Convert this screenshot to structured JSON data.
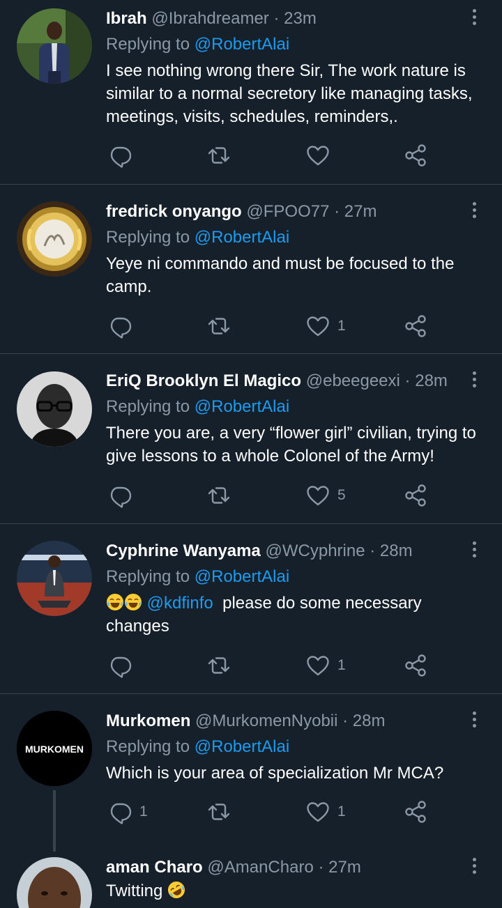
{
  "tweets": [
    {
      "name": "Ibrah",
      "handle": "@Ibrahdreamer",
      "sep": "·",
      "time": "23m",
      "replying_prefix": "Replying to",
      "replying_to": "@RobertAlai",
      "text": "I see nothing wrong there Sir, The work nature is similar to a normal secretory like managing tasks, meetings, visits, schedules, reminders,.",
      "reply_count": "",
      "retweet_count": "",
      "like_count": ""
    },
    {
      "name": "fredrick onyango",
      "handle": "@FPOO77",
      "sep": "·",
      "time": "27m",
      "replying_prefix": "Replying to",
      "replying_to": "@RobertAlai",
      "text": "Yeye ni commando and must be focused to the camp.",
      "reply_count": "",
      "retweet_count": "",
      "like_count": "1"
    },
    {
      "name": "EriQ Brooklyn El Magico",
      "handle": "@ebeegeexi",
      "sep": "·",
      "time": "28m",
      "replying_prefix": "Replying to",
      "replying_to": "@RobertAlai",
      "text": "There you are, a very “flower girl” civilian, trying to give lessons to a whole Colonel of the Army!",
      "reply_count": "",
      "retweet_count": "",
      "like_count": "5"
    },
    {
      "name": "Cyphrine Wanyama",
      "handle": "@WCyphrine",
      "sep": "·",
      "time": "28m",
      "replying_prefix": "Replying to",
      "replying_to": "@RobertAlai",
      "text_mention": "@kdfinfo",
      "text": "please do some necessary changes",
      "reply_count": "",
      "retweet_count": "",
      "like_count": "1"
    },
    {
      "name": "Murkomen",
      "handle": "@MurkomenNyobii",
      "sep": "·",
      "time": "28m",
      "replying_prefix": "Replying to",
      "replying_to": "@RobertAlai",
      "avatar_text": "MURKOMEN",
      "text": "Which is your area of specialization Mr MCA?",
      "reply_count": "1",
      "retweet_count": "",
      "like_count": "1"
    },
    {
      "name": "aman Charo",
      "handle": "@AmanCharo",
      "sep": "·",
      "time": "27m",
      "text": "Twitting"
    }
  ],
  "icons": {
    "reply": "reply-icon",
    "retweet": "retweet-icon",
    "like": "heart-icon",
    "share": "share-icon",
    "more": "more-vertical-icon",
    "emoji_laugh": "tears-of-joy-emoji",
    "emoji_rofl": "rolling-on-floor-laughing-emoji"
  },
  "colors": {
    "background": "#15202b",
    "divider": "#38444d",
    "secondary_text": "#8b98a5",
    "link": "#1d9bf0",
    "emoji": "#ffcc33"
  }
}
